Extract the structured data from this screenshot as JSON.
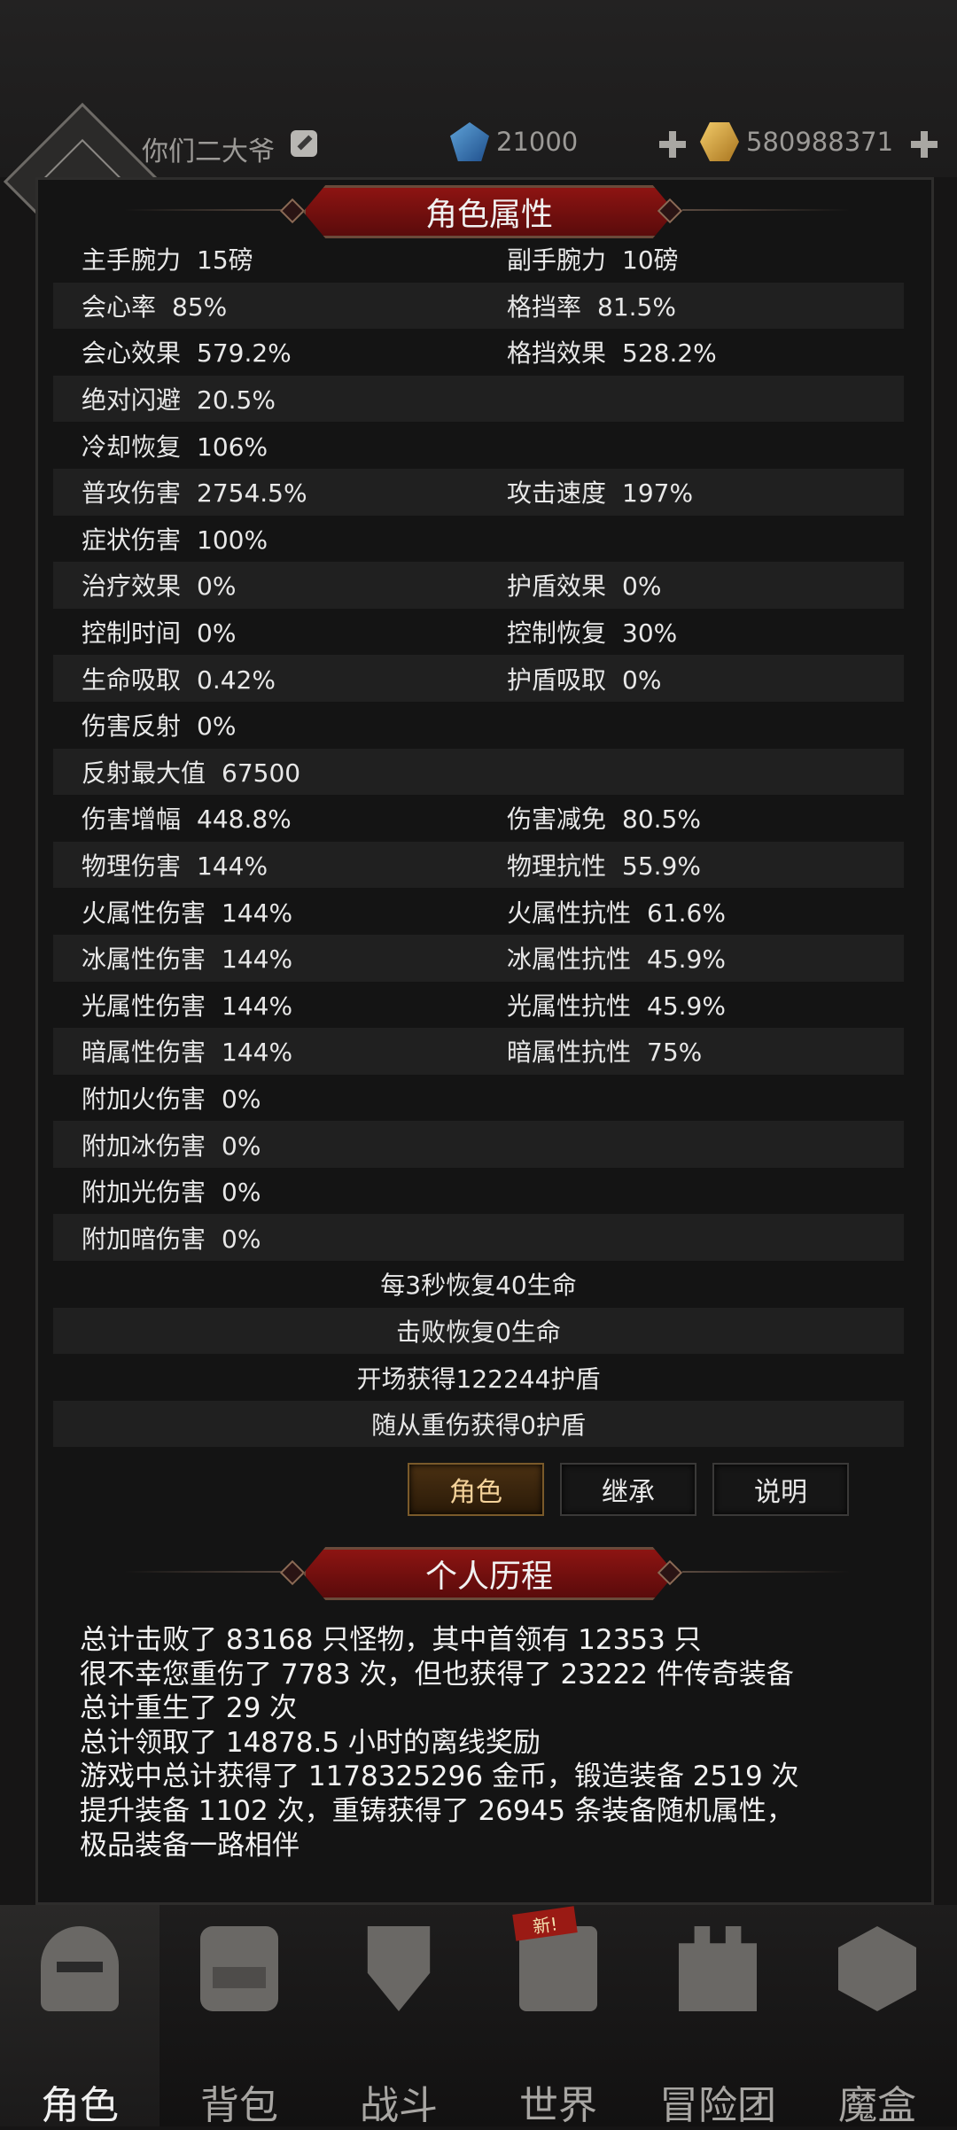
{
  "header": {
    "player_name": "你们二大爷",
    "diamonds": "21000",
    "gold": "580988371"
  },
  "attributes_title": "角色属性",
  "attributes": [
    {
      "l": "主手腕力",
      "lv": "15磅",
      "r": "副手腕力",
      "rv": "10磅"
    },
    {
      "l": "会心率",
      "lv": "85%",
      "r": "格挡率",
      "rv": "81.5%"
    },
    {
      "l": "会心效果",
      "lv": "579.2%",
      "r": "格挡效果",
      "rv": "528.2%"
    },
    {
      "l": "绝对闪避",
      "lv": "20.5%",
      "r": "",
      "rv": ""
    },
    {
      "l": "冷却恢复",
      "lv": "106%",
      "r": "",
      "rv": ""
    },
    {
      "l": "普攻伤害",
      "lv": "2754.5%",
      "r": "攻击速度",
      "rv": "197%"
    },
    {
      "l": "症状伤害",
      "lv": "100%",
      "r": "",
      "rv": ""
    },
    {
      "l": "治疗效果",
      "lv": "0%",
      "r": "护盾效果",
      "rv": "0%"
    },
    {
      "l": "控制时间",
      "lv": "0%",
      "r": "控制恢复",
      "rv": "30%"
    },
    {
      "l": "生命吸取",
      "lv": "0.42%",
      "r": "护盾吸取",
      "rv": "0%"
    },
    {
      "l": "伤害反射",
      "lv": "0%",
      "r": "",
      "rv": ""
    },
    {
      "l": "反射最大值",
      "lv": "67500",
      "r": "",
      "rv": ""
    },
    {
      "l": "伤害增幅",
      "lv": "448.8%",
      "r": "伤害减免",
      "rv": "80.5%"
    },
    {
      "l": "物理伤害",
      "lv": "144%",
      "r": "物理抗性",
      "rv": "55.9%"
    },
    {
      "l": "火属性伤害",
      "lv": "144%",
      "r": "火属性抗性",
      "rv": "61.6%"
    },
    {
      "l": "冰属性伤害",
      "lv": "144%",
      "r": "冰属性抗性",
      "rv": "45.9%"
    },
    {
      "l": "光属性伤害",
      "lv": "144%",
      "r": "光属性抗性",
      "rv": "45.9%"
    },
    {
      "l": "暗属性伤害",
      "lv": "144%",
      "r": "暗属性抗性",
      "rv": "75%"
    },
    {
      "l": "附加火伤害",
      "lv": "0%",
      "r": "",
      "rv": ""
    },
    {
      "l": "附加冰伤害",
      "lv": "0%",
      "r": "",
      "rv": ""
    },
    {
      "l": "附加光伤害",
      "lv": "0%",
      "r": "",
      "rv": ""
    },
    {
      "l": "附加暗伤害",
      "lv": "0%",
      "r": "",
      "rv": ""
    }
  ],
  "extra_lines": [
    "每3秒恢复40生命",
    "击败恢复0生命",
    "开场获得122244护盾",
    "随从重伤获得0护盾"
  ],
  "buttons": {
    "role": "角色",
    "inherit": "继承",
    "explain": "说明"
  },
  "history_title": "个人历程",
  "history_lines": [
    "总计击败了 83168 只怪物，其中首领有 12353 只",
    "很不幸您重伤了 7783 次，但也获得了 23222 件传奇装备",
    "总计重生了 29 次",
    "总计领取了 14878.5 小时的离线奖励",
    "游戏中总计获得了 1178325296 金币，锻造装备 2519 次",
    "提升装备 1102 次，重铸获得了 26945 条装备随机属性，",
    "极品装备一路相伴"
  ],
  "nav": {
    "new_badge": "新!",
    "items": [
      {
        "label": "角色"
      },
      {
        "label": "背包"
      },
      {
        "label": "战斗"
      },
      {
        "label": "世界"
      },
      {
        "label": "冒险团"
      },
      {
        "label": "魔盒"
      }
    ]
  }
}
